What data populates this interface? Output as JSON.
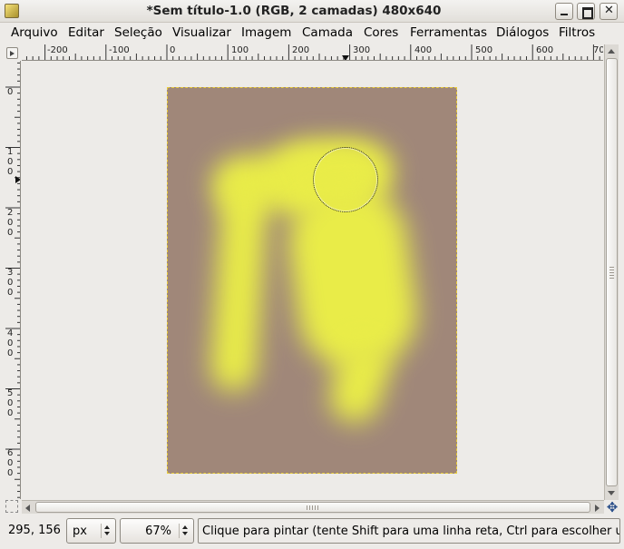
{
  "window": {
    "title": "*Sem título-1.0 (RGB, 2 camadas) 480x640",
    "icon": "gimp-wilber-icon"
  },
  "menubar": {
    "items": [
      "Arquivo",
      "Editar",
      "Seleção",
      "Visualizar",
      "Imagem",
      "Camada",
      "Cores",
      "Ferramentas",
      "Diálogos",
      "Filtros"
    ]
  },
  "rulers": {
    "horizontal_labels": [
      "-200",
      "-100",
      "0",
      "100",
      "200",
      "300",
      "400",
      "500",
      "600",
      "70"
    ],
    "vertical_labels": [
      "0",
      "100",
      "200",
      "300",
      "400",
      "500",
      "600"
    ]
  },
  "canvas": {
    "background_color": "#a08779",
    "paint_color": "#e9ec48"
  },
  "statusbar": {
    "coords": "295, 156",
    "unit": "px",
    "zoom": "67%",
    "message": "Clique para pintar (tente Shift para uma linha reta, Ctrl para escolher u..."
  }
}
